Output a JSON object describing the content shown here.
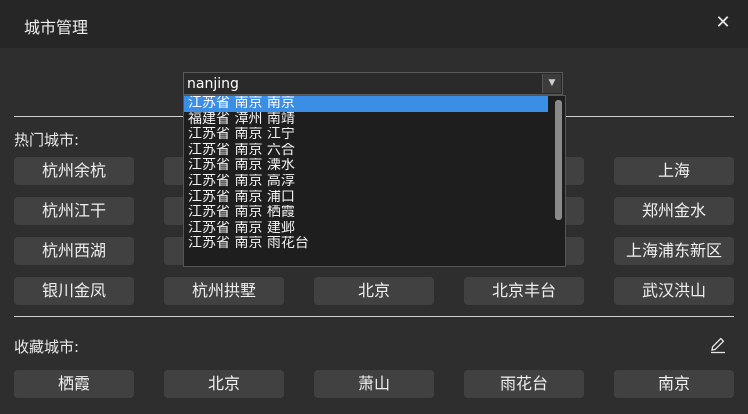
{
  "window": {
    "title": "城市管理",
    "close_icon": "close-icon"
  },
  "search": {
    "value": "nanjing"
  },
  "dropdown": {
    "items": [
      "江苏省  南京  南京",
      "福建省  漳州  南靖",
      "江苏省  南京  江宁",
      "江苏省  南京  六合",
      "江苏省  南京  溧水",
      "江苏省  南京  高淳",
      "江苏省  南京  浦口",
      "江苏省  南京  栖霞",
      "江苏省  南京  建邺",
      "江苏省  南京  雨花台"
    ],
    "selected_index": 0
  },
  "hot": {
    "label": "热门城市:",
    "buttons": [
      "杭州余杭",
      "上海",
      "杭州江干",
      "郑州金水",
      "杭州西湖",
      "上海浦东新区",
      "银川金凤",
      "杭州拱墅",
      "北京",
      "北京丰台",
      "武汉洪山"
    ]
  },
  "favorites": {
    "label": "收藏城市:",
    "edit_icon": "pencil-icon",
    "buttons": [
      "栖霞",
      "北京",
      "萧山",
      "雨花台",
      "南京"
    ]
  },
  "colors": {
    "accent": "#3a8ee6",
    "button_bg": "#414141",
    "window_bg": "#2e2e2e"
  }
}
